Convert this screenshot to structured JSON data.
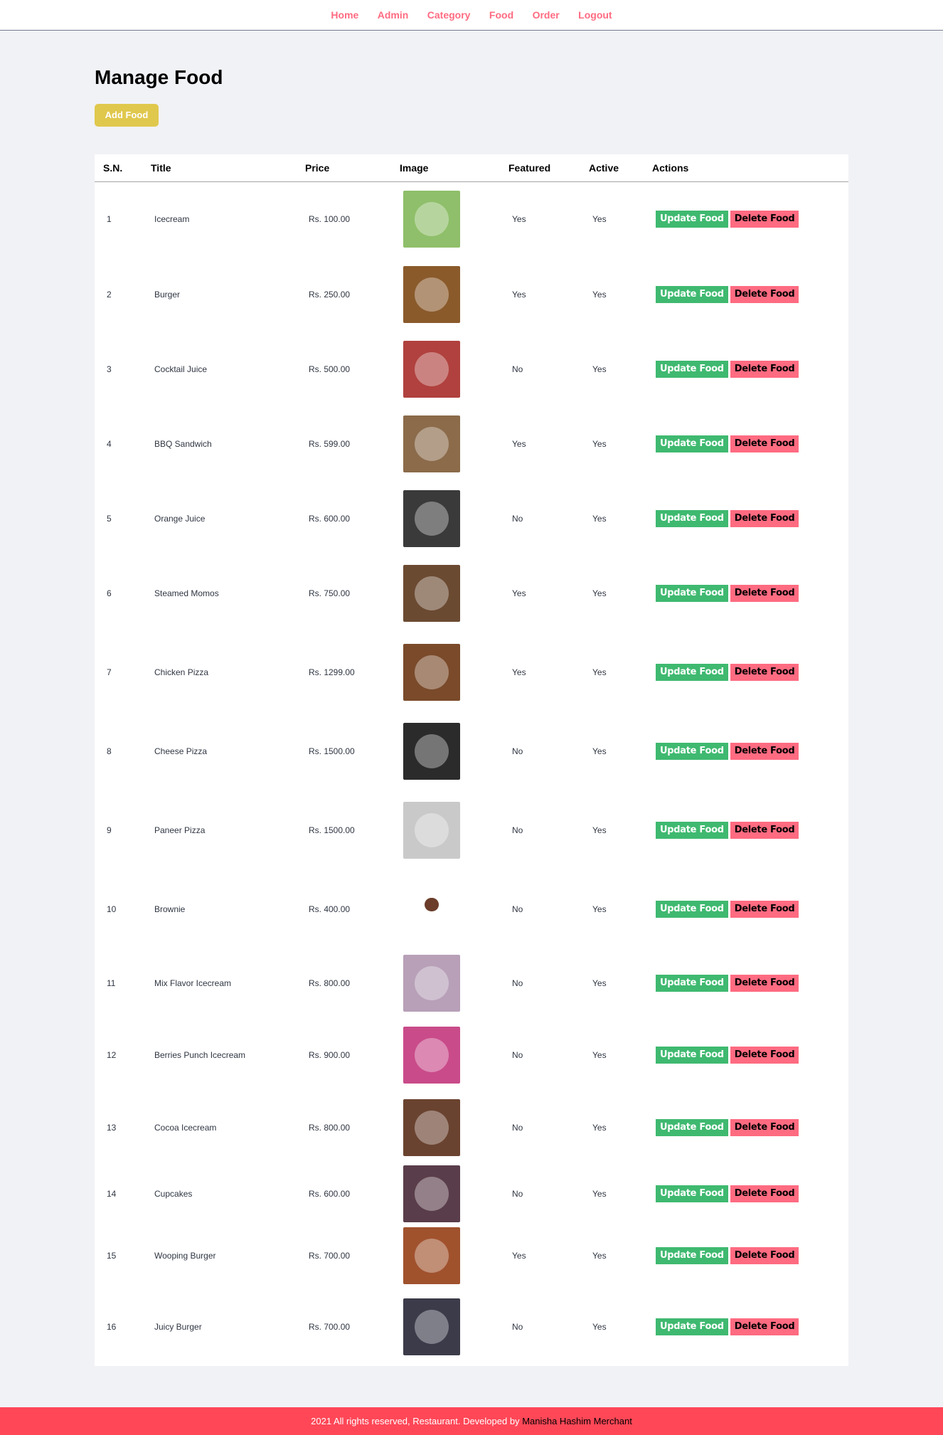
{
  "nav": {
    "items": [
      "Home",
      "Admin",
      "Category",
      "Food",
      "Order",
      "Logout"
    ]
  },
  "page": {
    "title": "Manage Food",
    "add_button": "Add Food"
  },
  "table": {
    "headers": [
      "S.N.",
      "Title",
      "Price",
      "Image",
      "Featured",
      "Active",
      "Actions"
    ],
    "update_label": "Update Food",
    "delete_label": "Delete Food",
    "rows": [
      {
        "sn": "1",
        "title": "Icecream",
        "price": "Rs. 100.00",
        "featured": "Yes",
        "active": "Yes",
        "image": "icecream-photo",
        "color": "#8fbf6a"
      },
      {
        "sn": "2",
        "title": "Burger",
        "price": "Rs. 250.00",
        "featured": "Yes",
        "active": "Yes",
        "image": "burger-photo",
        "color": "#8a5a2b"
      },
      {
        "sn": "3",
        "title": "Cocktail Juice",
        "price": "Rs. 500.00",
        "featured": "No",
        "active": "Yes",
        "image": "cocktail-juice-photo",
        "color": "#b0413e"
      },
      {
        "sn": "4",
        "title": "BBQ Sandwich",
        "price": "Rs. 599.00",
        "featured": "Yes",
        "active": "Yes",
        "image": "bbq-sandwich-photo",
        "color": "#8b6b4a"
      },
      {
        "sn": "5",
        "title": "Orange Juice",
        "price": "Rs. 600.00",
        "featured": "No",
        "active": "Yes",
        "image": "orange-juice-photo",
        "color": "#3a3a3a"
      },
      {
        "sn": "6",
        "title": "Steamed Momos",
        "price": "Rs. 750.00",
        "featured": "Yes",
        "active": "Yes",
        "image": "steamed-momos-photo",
        "color": "#6b4a32"
      },
      {
        "sn": "7",
        "title": "Chicken Pizza",
        "price": "Rs. 1299.00",
        "featured": "Yes",
        "active": "Yes",
        "image": "chicken-pizza-photo",
        "color": "#7a4a2a"
      },
      {
        "sn": "8",
        "title": "Cheese Pizza",
        "price": "Rs. 1500.00",
        "featured": "No",
        "active": "Yes",
        "image": "cheese-pizza-photo",
        "color": "#2b2b2b"
      },
      {
        "sn": "9",
        "title": "Paneer Pizza",
        "price": "Rs. 1500.00",
        "featured": "No",
        "active": "Yes",
        "image": "paneer-pizza-photo",
        "color": "#c9c9c9"
      },
      {
        "sn": "10",
        "title": "Brownie",
        "price": "Rs. 400.00",
        "featured": "No",
        "active": "Yes",
        "image": "brownie-photo",
        "color": "#ffffff"
      },
      {
        "sn": "11",
        "title": "Mix Flavor Icecream",
        "price": "Rs. 800.00",
        "featured": "No",
        "active": "Yes",
        "image": "mix-flavor-icecream-photo",
        "color": "#b7a0b8"
      },
      {
        "sn": "12",
        "title": "Berries Punch Icecream",
        "price": "Rs. 900.00",
        "featured": "No",
        "active": "Yes",
        "image": "berries-punch-icecream-photo",
        "color": "#c94b8a"
      },
      {
        "sn": "13",
        "title": "Cocoa Icecream",
        "price": "Rs. 800.00",
        "featured": "No",
        "active": "Yes",
        "image": "cocoa-icecream-photo",
        "color": "#6a4330"
      },
      {
        "sn": "14",
        "title": "Cupcakes",
        "price": "Rs. 600.00",
        "featured": "No",
        "active": "Yes",
        "image": "cupcakes-photo",
        "color": "#5a3d4a"
      },
      {
        "sn": "15",
        "title": "Wooping Burger",
        "price": "Rs. 700.00",
        "featured": "Yes",
        "active": "Yes",
        "image": "wooping-burger-photo",
        "color": "#a0522d"
      },
      {
        "sn": "16",
        "title": "Juicy Burger",
        "price": "Rs. 700.00",
        "featured": "No",
        "active": "Yes",
        "image": "juicy-burger-photo",
        "color": "#3b3b4a"
      }
    ]
  },
  "footer": {
    "text": "2021 All rights reserved, Restaurant. Developed by ",
    "author": "Manisha Hashim Merchant"
  },
  "colors": {
    "nav_link": "#ff6b81",
    "add_button": "#e0c84d",
    "update_button": "#3fb970",
    "delete_button": "#ff6b81",
    "footer_bg": "#ff4757"
  }
}
